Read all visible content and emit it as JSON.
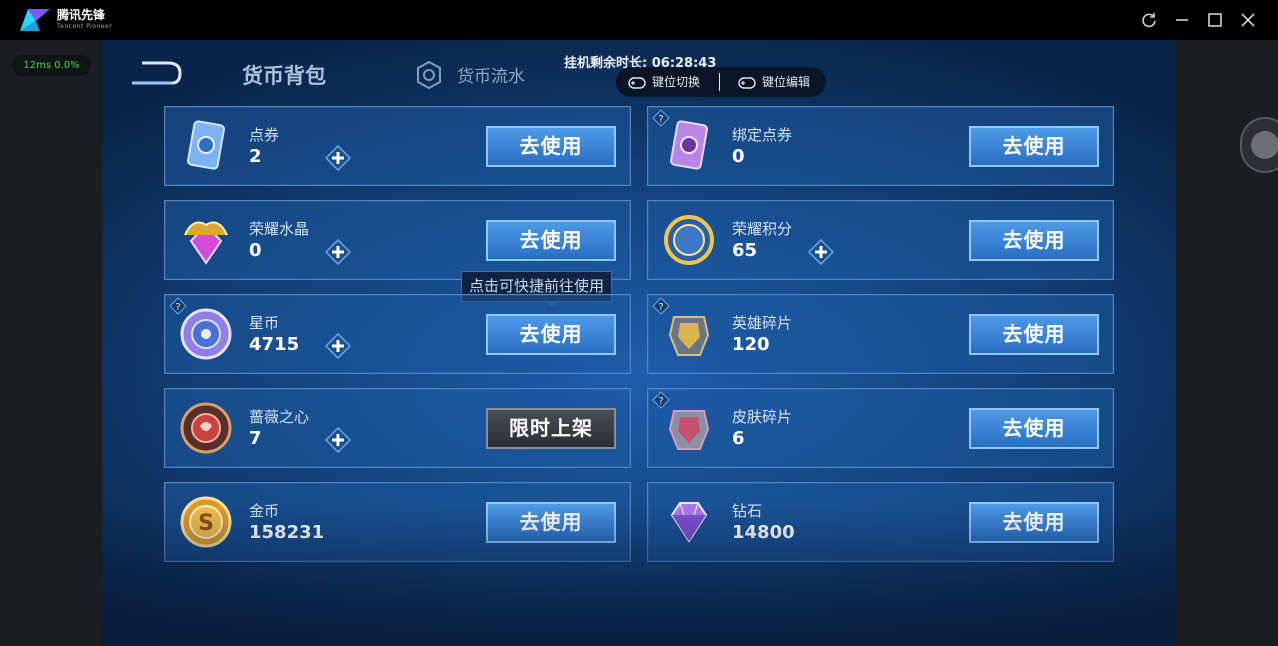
{
  "app": {
    "brand": "腾讯先锋",
    "brand_sub": "Tencent Pioneer",
    "ping": "12ms  0.0%"
  },
  "header": {
    "tab_active": "货币背包",
    "tab_flow": "货币流水",
    "timer": "挂机剩余时长: 06:28:43",
    "key_switch": "键位切换",
    "key_edit": "键位编辑"
  },
  "tooltip": "点击可快捷前往使用",
  "currencies": [
    {
      "name": "点券",
      "amount": "2",
      "button": "去使用"
    },
    {
      "name": "绑定点券",
      "amount": "0",
      "button": "去使用"
    },
    {
      "name": "荣耀水晶",
      "amount": "0",
      "button": "去使用"
    },
    {
      "name": "荣耀积分",
      "amount": "65",
      "button": "去使用"
    },
    {
      "name": "星币",
      "amount": "4715",
      "button": "去使用"
    },
    {
      "name": "英雄碎片",
      "amount": "120",
      "button": "去使用"
    },
    {
      "name": "蔷薇之心",
      "amount": "7",
      "button": "限时上架"
    },
    {
      "name": "皮肤碎片",
      "amount": "6",
      "button": "去使用"
    },
    {
      "name": "金币",
      "amount": "158231",
      "button": "去使用"
    },
    {
      "name": "钻石",
      "amount": "14800",
      "button": "去使用"
    }
  ],
  "icons": {
    "refresh": "refresh-icon",
    "minimize": "minimize-icon",
    "maximize": "maximize-icon",
    "close": "close-icon"
  },
  "colors": {
    "accent": "#2a6fc2",
    "ping_green": "#46d64f"
  }
}
